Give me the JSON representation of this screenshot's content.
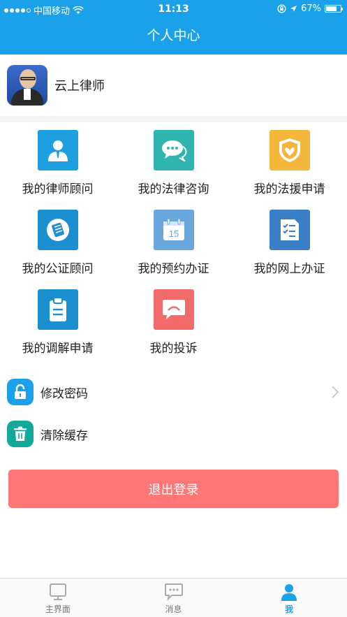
{
  "status_bar": {
    "carrier": "中国移动",
    "time": "11:13",
    "battery": "67%"
  },
  "nav": {
    "title": "个人中心"
  },
  "profile": {
    "name": "云上律师"
  },
  "grid": [
    {
      "label": "我的律师顾问",
      "icon": "lawyer-person-icon",
      "color": "#1ea0e0"
    },
    {
      "label": "我的法律咨询",
      "icon": "chat-bubble-icon",
      "color": "#2fb5b0"
    },
    {
      "label": "我的法援申请",
      "icon": "legal-aid-badge-icon",
      "color": "#f5b63c"
    },
    {
      "label": "我的公证顾问",
      "icon": "notary-document-icon",
      "color": "#1b8fd0"
    },
    {
      "label": "我的预约办证",
      "icon": "calendar-icon",
      "color": "#6aa7dc"
    },
    {
      "label": "我的网上办证",
      "icon": "checklist-icon",
      "color": "#3b80c6"
    },
    {
      "label": "我的调解申请",
      "icon": "clipboard-icon",
      "color": "#1b8fd0"
    },
    {
      "label": "我的投诉",
      "icon": "complaint-bubble-icon",
      "color": "#f26a6a"
    }
  ],
  "settings": [
    {
      "label": "修改密码",
      "icon": "lock-icon",
      "color": "#1aa1e9"
    },
    {
      "label": "清除缓存",
      "icon": "trash-icon",
      "color": "#12a89a"
    }
  ],
  "logout_label": "退出登录",
  "tabs": [
    {
      "label": "主界面",
      "icon": "monitor-icon",
      "active": false
    },
    {
      "label": "消息",
      "icon": "message-icon",
      "active": false
    },
    {
      "label": "我",
      "icon": "user-icon",
      "active": true
    }
  ]
}
